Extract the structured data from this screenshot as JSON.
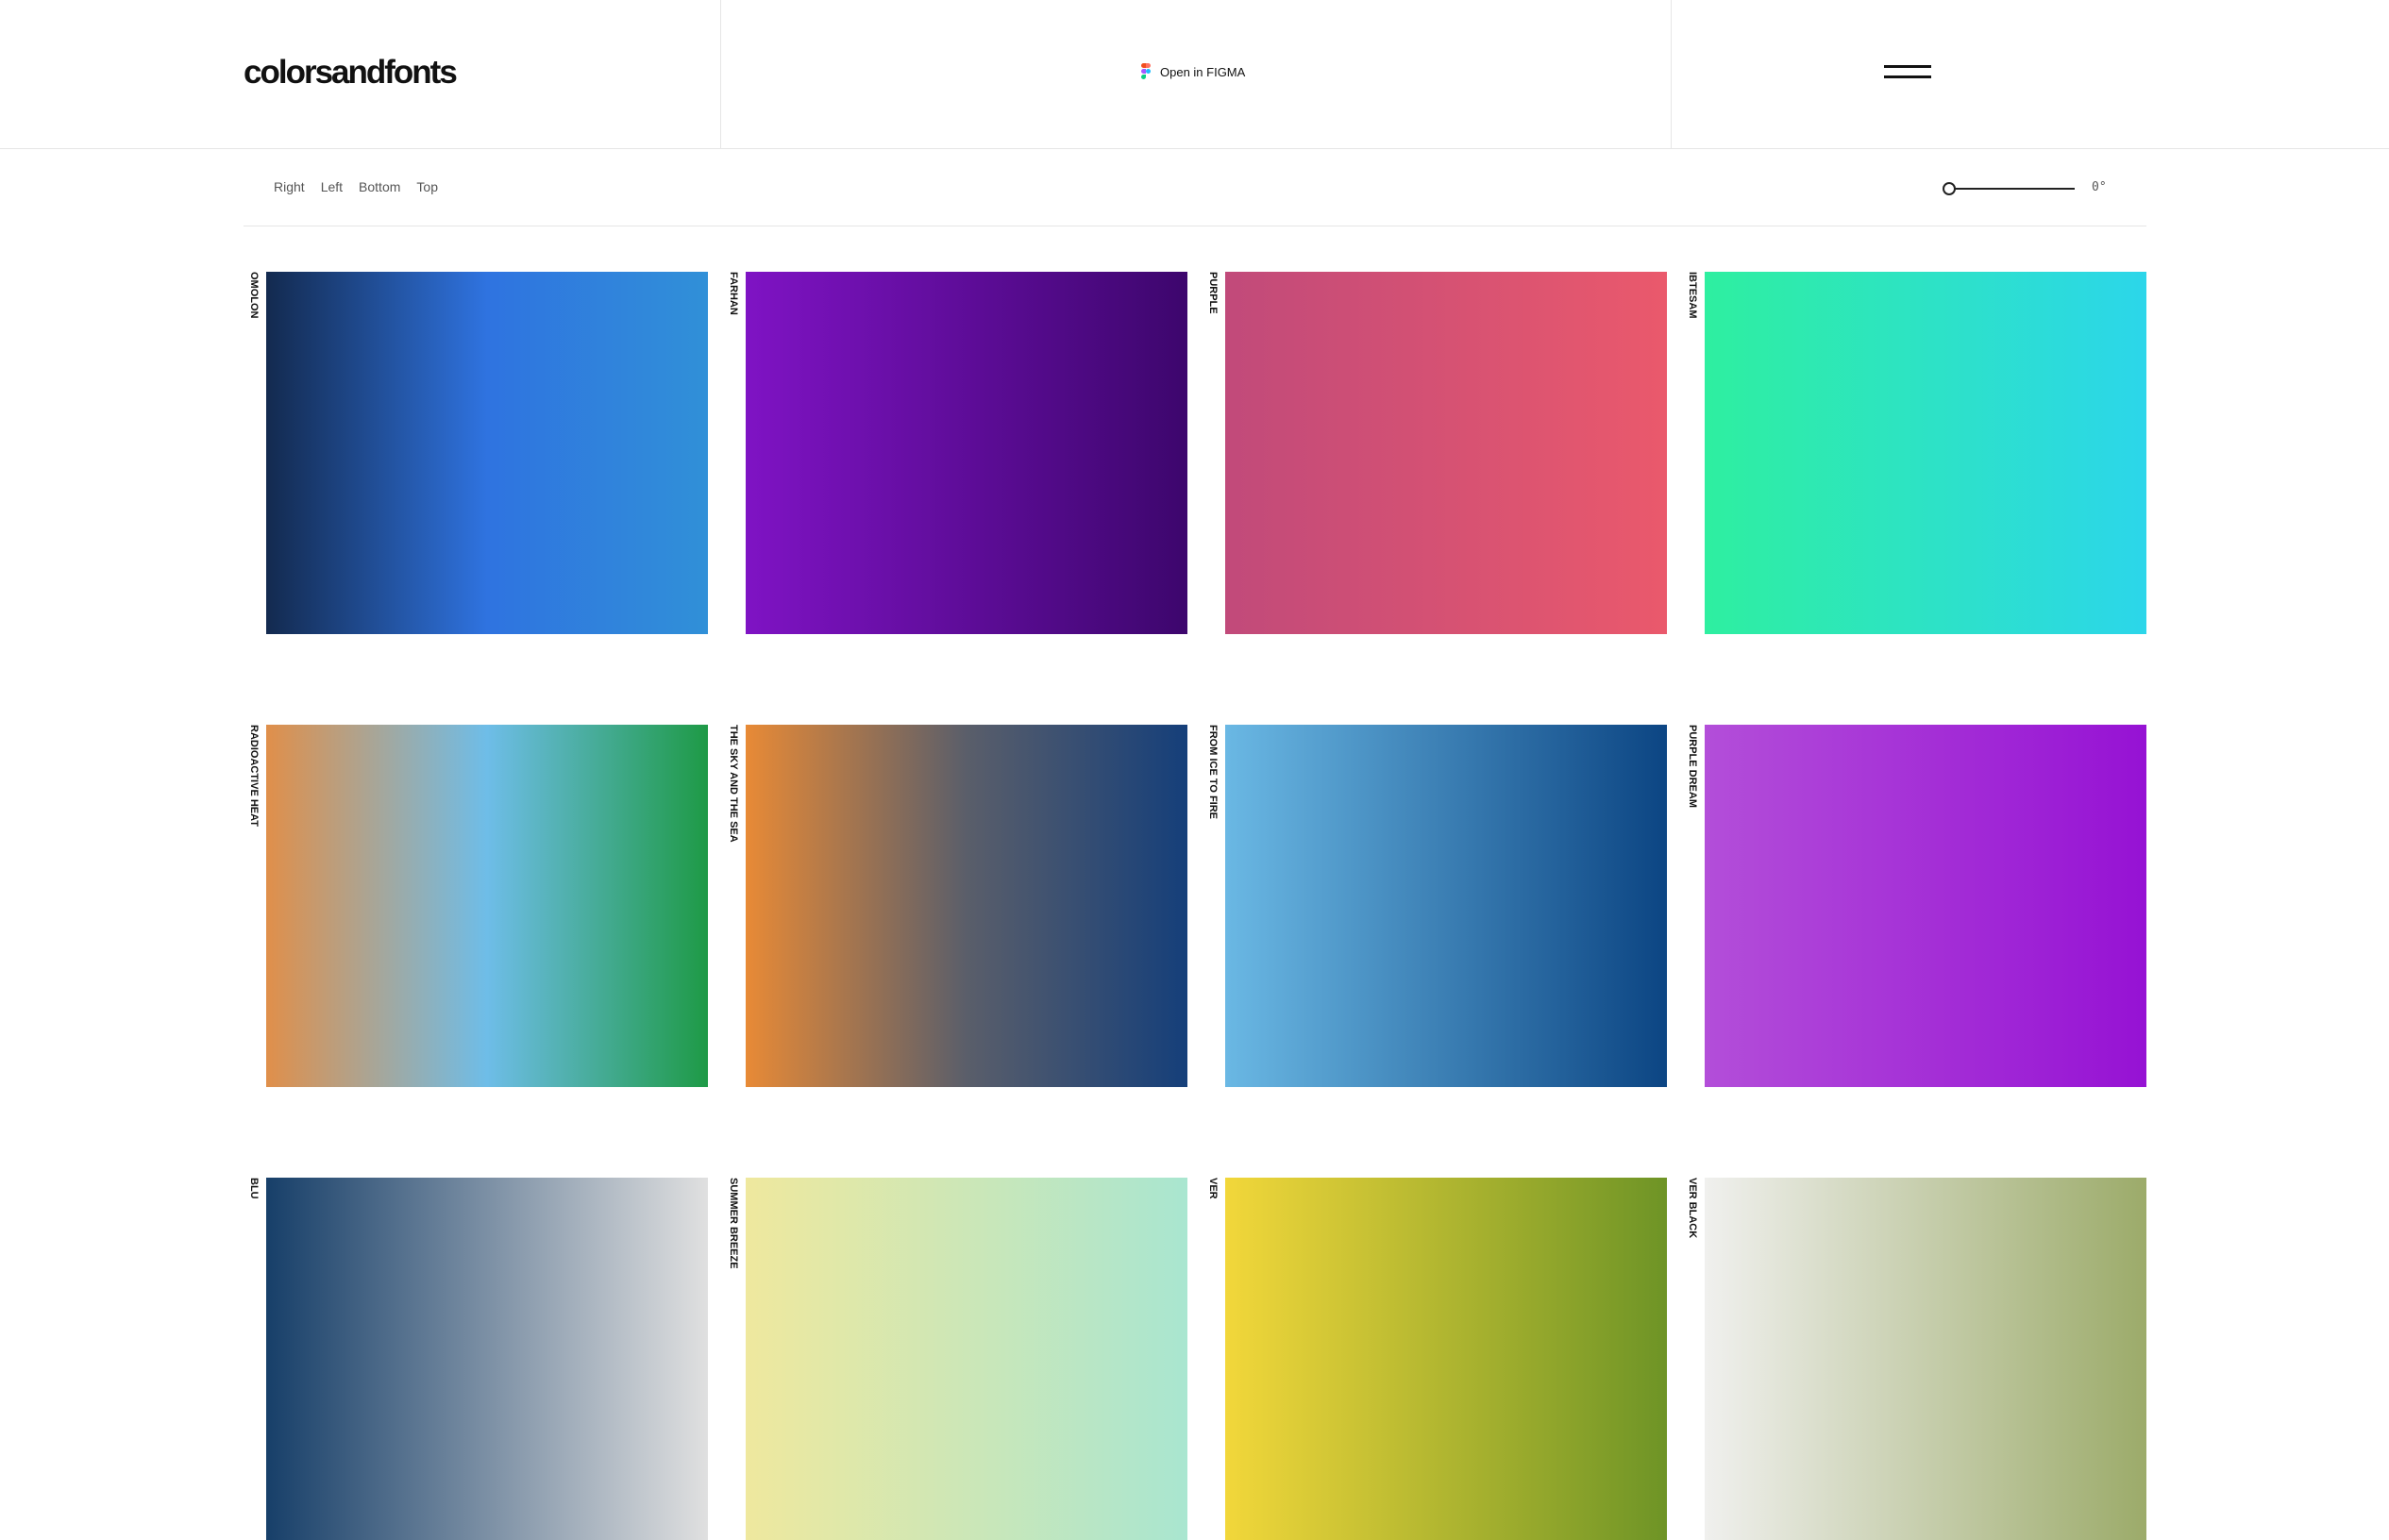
{
  "header": {
    "logo": "colorsandfonts",
    "figma_label": "Open in FIGMA"
  },
  "toolbar": {
    "directions": [
      "Right",
      "Left",
      "Bottom",
      "Top"
    ],
    "angle": "0°"
  },
  "gradients": [
    {
      "name": "OMOLON",
      "colors": [
        "#132a4f",
        "#2f73e0",
        "#3090d8"
      ]
    },
    {
      "name": "FARHAN",
      "colors": [
        "#7f13c4",
        "#3d066d"
      ]
    },
    {
      "name": "PURPLE",
      "colors": [
        "#c14a7a",
        "#ea596c"
      ]
    },
    {
      "name": "IBTESAM",
      "colors": [
        "#2eefa0",
        "#2cd6ea"
      ]
    },
    {
      "name": "RADIOACTIVE HEAT",
      "colors": [
        "#e08f4a",
        "#6ebde8",
        "#1e9a46"
      ]
    },
    {
      "name": "THE SKY AND THE SEA",
      "colors": [
        "#e88a36",
        "#5a5e6a",
        "#153f7a"
      ]
    },
    {
      "name": "FROM ICE TO FIRE",
      "colors": [
        "#6ab8e4",
        "#0c4583"
      ]
    },
    {
      "name": "PURPLE DREAM",
      "colors": [
        "#b34ed9",
        "#9612d4"
      ]
    },
    {
      "name": "BLU",
      "colors": [
        "#173f69",
        "#e0e0e0"
      ]
    },
    {
      "name": "SUMMER BREEZE",
      "colors": [
        "#efe89e",
        "#a9e6d0"
      ]
    },
    {
      "name": "VER",
      "colors": [
        "#f2d73a",
        "#6e9426"
      ]
    },
    {
      "name": "VER BLACK",
      "colors": [
        "#f0f0ee",
        "#9cab6a"
      ]
    }
  ]
}
